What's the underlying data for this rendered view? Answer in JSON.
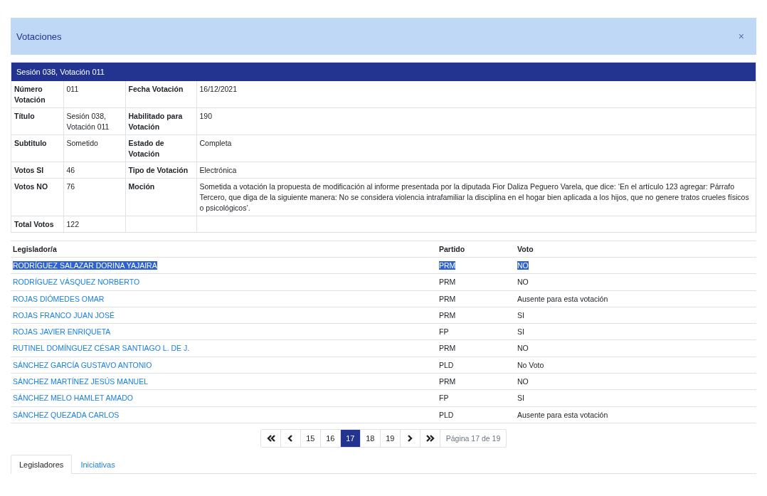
{
  "modal": {
    "title": "Votaciones",
    "close": "×"
  },
  "panel": {
    "title": "Sesión 038, Votación 011",
    "rows": [
      {
        "cells": [
          {
            "label": "Número Votación",
            "value": "011"
          },
          {
            "label": "Fecha Votación",
            "value": "16/12/2021"
          }
        ]
      },
      {
        "cells": [
          {
            "label": "Título",
            "value": "Sesión 038, Votación 011"
          },
          {
            "label": "Habilitado para Votación",
            "value": "190"
          }
        ]
      },
      {
        "cells": [
          {
            "label": "Subtitulo",
            "value": "Sometido"
          },
          {
            "label": "Estado de Votación",
            "value": "Completa"
          }
        ]
      },
      {
        "cells": [
          {
            "label": "Votos SI",
            "value": "46"
          },
          {
            "label": "Tipo de Votación",
            "value": "Electrónica"
          }
        ]
      },
      {
        "cells": [
          {
            "label": "Votos NO",
            "value": "76"
          },
          {
            "label": "Moción",
            "value": "Sometida a votación la propuesta de modificación al informe presentada por la diputada Fior Daliza Peguero Varela, que dice: ‘En el artículo 123 agregar: Párrafo Tercero, que diga de la siguiente manera: No se considera violencia intrafamiliar la disciplina en el hogar bien aplicada a los hijos, que no genere tratos crueles físicos o psicológicos’."
          }
        ]
      },
      {
        "cells": [
          {
            "label": "Total Votos",
            "value": "122"
          }
        ]
      }
    ]
  },
  "table": {
    "columns": [
      "Legislador/a",
      "Partido",
      "Voto"
    ],
    "rows": [
      {
        "name": "RODRÍGUEZ SALAZAR DORINA YAJAIRA",
        "party": "PRM",
        "vote": "NO",
        "highlighted": true
      },
      {
        "name": "RODRÍGUEZ VÁSQUEZ NORBERTO",
        "party": "PRM",
        "vote": "NO",
        "highlighted": false
      },
      {
        "name": "ROJAS DIÓMEDES OMAR",
        "party": "PRM",
        "vote": "Ausente para esta votación",
        "highlighted": false
      },
      {
        "name": "ROJAS FRANCO JUAN JOSÉ",
        "party": "PRM",
        "vote": "SI",
        "highlighted": false
      },
      {
        "name": "ROJAS JAVIER ENRIQUETA",
        "party": "FP",
        "vote": "SI",
        "highlighted": false
      },
      {
        "name": "RUTINEL DOMÍNGUEZ CÉSAR SANTIAGO L. DE J.",
        "party": "PRM",
        "vote": "NO",
        "highlighted": false
      },
      {
        "name": "SÁNCHEZ GARCÍA GUSTAVO ANTONIO",
        "party": "PLD",
        "vote": "No Voto",
        "highlighted": false
      },
      {
        "name": "SÁNCHEZ MARTÍNEZ JESÚS MANUEL",
        "party": "PRM",
        "vote": "NO",
        "highlighted": false
      },
      {
        "name": "SÁNCHEZ MELO HAMLET AMADO",
        "party": "FP",
        "vote": "SI",
        "highlighted": false
      },
      {
        "name": "SÁNCHEZ QUEZADA CARLOS",
        "party": "PLD",
        "vote": "Ausente para esta votación",
        "highlighted": false
      }
    ]
  },
  "pagination": {
    "items": [
      {
        "kind": "first",
        "selected": false
      },
      {
        "kind": "prev",
        "selected": false
      },
      {
        "kind": "page",
        "label": "15",
        "selected": false
      },
      {
        "kind": "page",
        "label": "16",
        "selected": false
      },
      {
        "kind": "page",
        "label": "17",
        "selected": true
      },
      {
        "kind": "page",
        "label": "18",
        "selected": false
      },
      {
        "kind": "page",
        "label": "19",
        "selected": false
      },
      {
        "kind": "next",
        "selected": false
      },
      {
        "kind": "last",
        "selected": false
      }
    ],
    "info": "Página 17 de 19"
  },
  "tabs": [
    {
      "label": "Legisladores",
      "selected": true
    },
    {
      "label": "Iniciativas",
      "selected": false
    }
  ]
}
